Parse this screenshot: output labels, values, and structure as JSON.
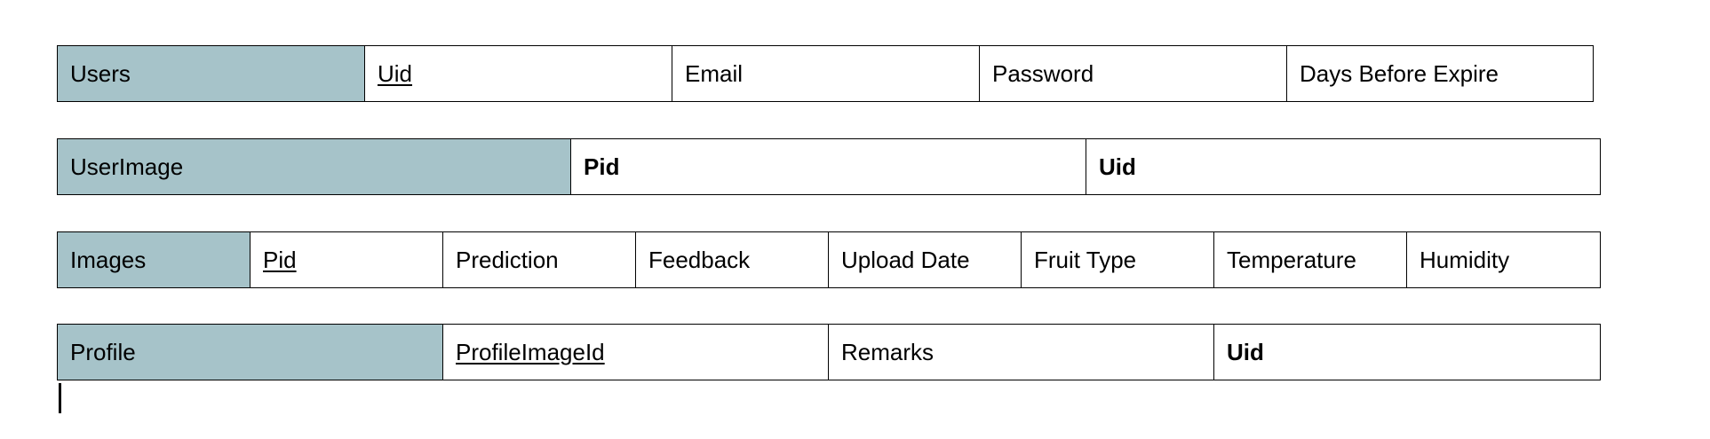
{
  "tables": [
    {
      "name": "Users",
      "fields": [
        {
          "label": "Uid",
          "style": "pk"
        },
        {
          "label": "Email",
          "style": "normal"
        },
        {
          "label": "Password",
          "style": "normal"
        },
        {
          "label": "Days Before Expire",
          "style": "normal"
        }
      ]
    },
    {
      "name": "UserImage",
      "fields": [
        {
          "label": "Pid",
          "style": "fk"
        },
        {
          "label": "Uid",
          "style": "fk"
        }
      ]
    },
    {
      "name": "Images",
      "fields": [
        {
          "label": "Pid",
          "style": "pk"
        },
        {
          "label": "Prediction",
          "style": "normal"
        },
        {
          "label": "Feedback",
          "style": "normal"
        },
        {
          "label": "Upload Date",
          "style": "normal"
        },
        {
          "label": "Fruit Type",
          "style": "normal"
        },
        {
          "label": "Temperature",
          "style": "normal"
        },
        {
          "label": "Humidity",
          "style": "normal"
        }
      ]
    },
    {
      "name": "Profile",
      "fields": [
        {
          "label": "ProfileImageId",
          "style": "pk"
        },
        {
          "label": "Remarks",
          "style": "normal"
        },
        {
          "label": "Uid",
          "style": "fk"
        }
      ]
    }
  ],
  "colors": {
    "table_name_fill": "#a6c3c9",
    "border": "#000000"
  }
}
